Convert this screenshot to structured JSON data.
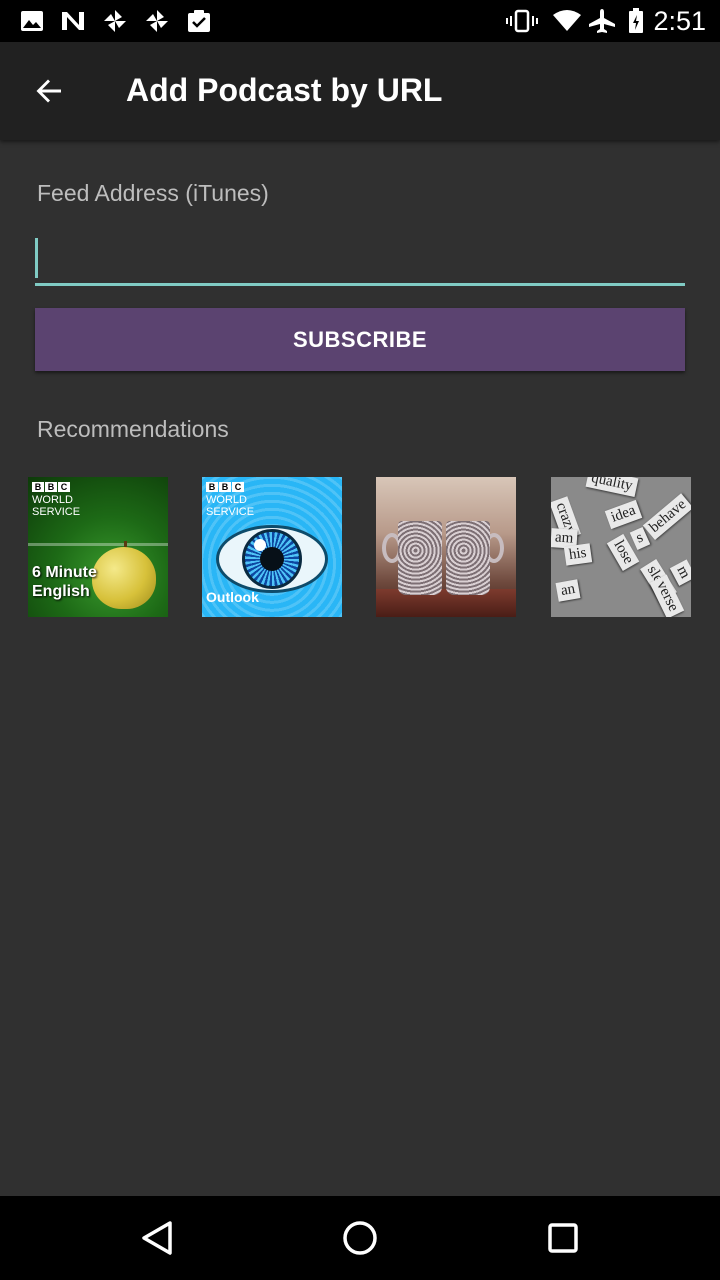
{
  "status_bar": {
    "time": "2:51",
    "left_icons": [
      "image-icon",
      "n-icon",
      "pinwheel-icon",
      "pinwheel-icon",
      "clipboard-check-icon"
    ],
    "right_icons": [
      "vibrate-icon",
      "wifi-icon",
      "airplane-icon",
      "battery-icon"
    ]
  },
  "app_bar": {
    "title": "Add Podcast by URL",
    "back_icon": "arrow-back-icon"
  },
  "feed": {
    "label": "Feed Address (iTunes)",
    "value": "",
    "placeholder": ""
  },
  "subscribe": {
    "label": "SUBSCRIBE"
  },
  "recommendations": {
    "label": "Recommendations",
    "items": [
      {
        "logo_letters": [
          "B",
          "B",
          "C"
        ],
        "line1": "WORLD",
        "line2": "SERVICE",
        "title_line1": "6 Minute",
        "title_line2": "English"
      },
      {
        "logo_letters": [
          "B",
          "B",
          "C"
        ],
        "line1": "WORLD",
        "line2": "SERVICE",
        "title": "Outlook"
      },
      {
        "description": "mugs-cover"
      },
      {
        "words": [
          "quality",
          "crazy",
          "idea",
          "behave",
          "am",
          "his",
          "lose",
          "s",
          "sleep",
          "an",
          "verse",
          "m"
        ]
      }
    ]
  },
  "nav_bar": {
    "icons": [
      "back-triangle-icon",
      "home-circle-icon",
      "recents-square-icon"
    ]
  },
  "colors": {
    "background": "#303030",
    "app_bar": "#212121",
    "accent": "#80cbc4",
    "button": "#5b4370",
    "label": "#bdbdbd"
  }
}
